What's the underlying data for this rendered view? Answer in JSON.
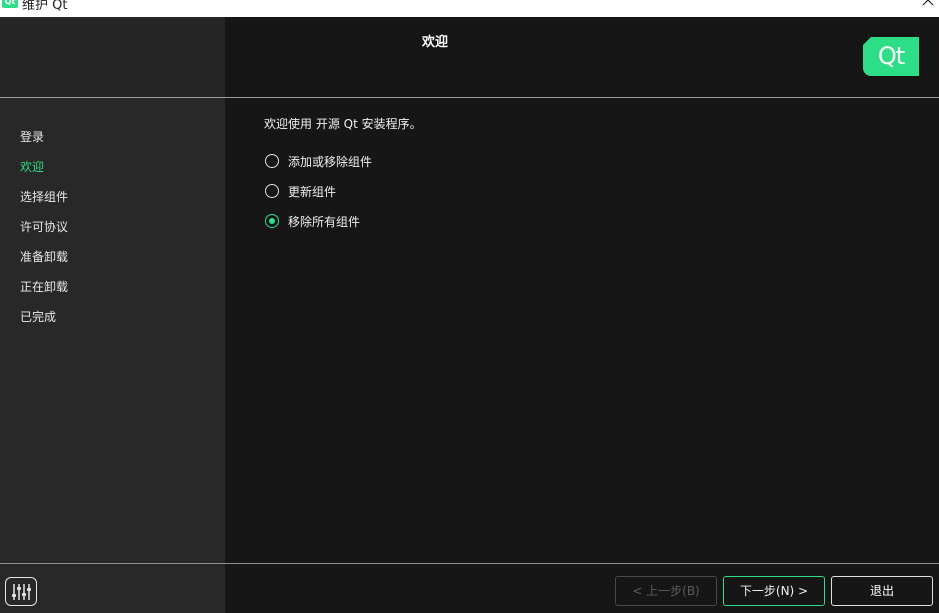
{
  "window": {
    "title": "维护 Qt",
    "icon_text": "Qt"
  },
  "header": {
    "title": "欢迎",
    "logo_text": "Qt"
  },
  "steps": [
    {
      "label": "登录",
      "active": false
    },
    {
      "label": "欢迎",
      "active": true
    },
    {
      "label": "选择组件",
      "active": false
    },
    {
      "label": "许可协议",
      "active": false
    },
    {
      "label": "准备卸载",
      "active": false
    },
    {
      "label": "正在卸载",
      "active": false
    },
    {
      "label": "已完成",
      "active": false
    }
  ],
  "main": {
    "welcome_text": "欢迎使用 开源 Qt 安装程序。",
    "options": [
      {
        "label": "添加或移除组件",
        "checked": false
      },
      {
        "label": "更新组件",
        "checked": false
      },
      {
        "label": "移除所有组件",
        "checked": true
      }
    ]
  },
  "footer": {
    "back_label": "< 上一步(B)",
    "next_label": "下一步(N) >",
    "quit_label": "退出"
  },
  "colors": {
    "accent": "#2cde85",
    "background": "#161616",
    "sidebar": "#282828"
  },
  "icons": {
    "settings": "settings-sliders-icon",
    "close": "close-icon"
  }
}
